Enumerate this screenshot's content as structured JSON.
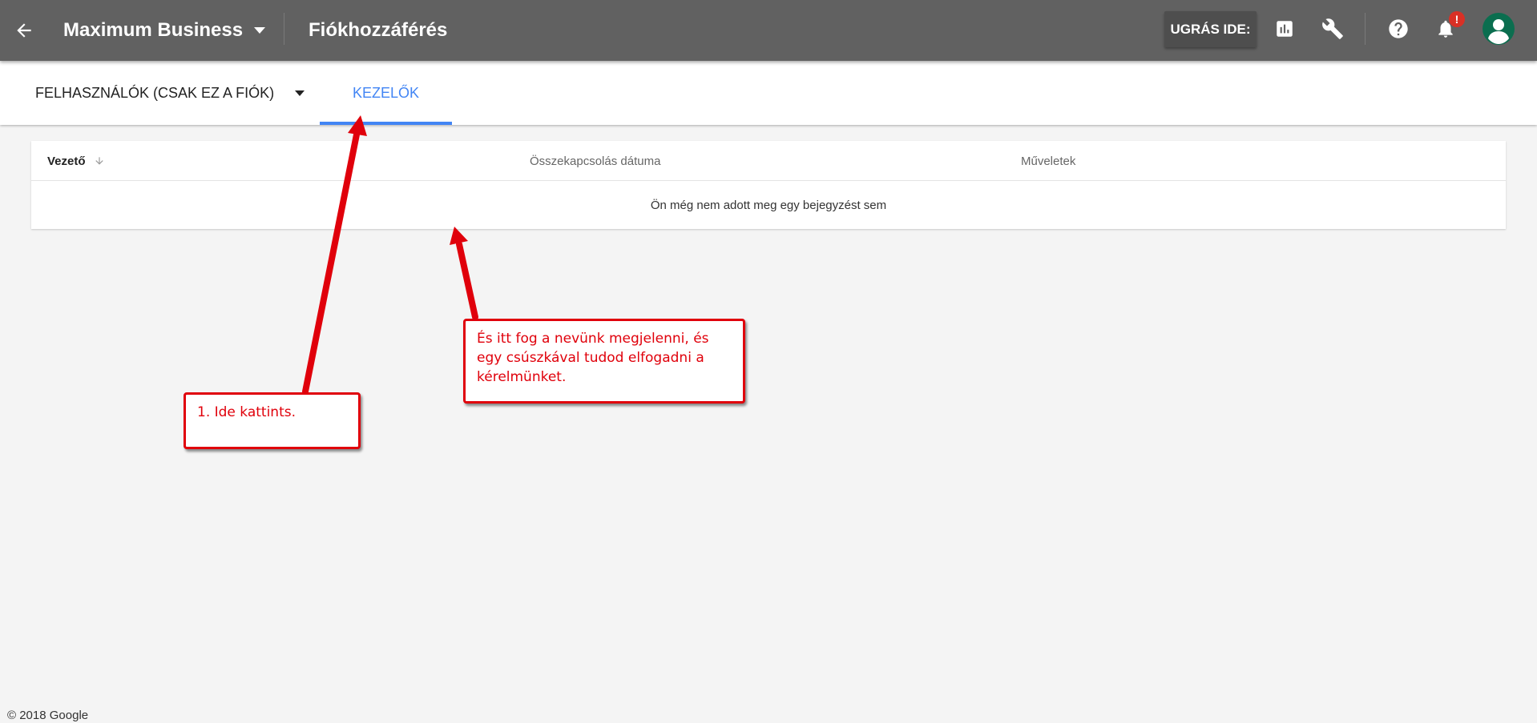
{
  "topbar": {
    "account_name": "Maximum Business",
    "page_title": "Fiókhozzáférés",
    "goto_label": "UGRÁS IDE:",
    "notification_badge": "!",
    "icons": {
      "back": "arrow-back-icon",
      "account_caret": "caret-down-icon",
      "reports": "bar-chart-icon",
      "tools": "wrench-icon",
      "help": "help-icon",
      "notifications": "bell-icon",
      "avatar": "account-avatar-icon"
    },
    "colors": {
      "bar": "#616161",
      "badge": "#d93025"
    }
  },
  "tabs": {
    "users_label": "FELHASZNÁLÓK (CSAK EZ A FIÓK)",
    "managers_label": "KEZELŐK",
    "active": "managers",
    "accent_color": "#4285f4"
  },
  "table": {
    "columns": [
      "Vezető",
      "Összekapcsolás dátuma",
      "Műveletek"
    ],
    "sort_column": "Vezető",
    "sort_direction": "descending",
    "empty_message": "Ön még nem adott meg egy bejegyzést sem"
  },
  "annotations": {
    "callout_1": "1. Ide kattints.",
    "callout_2": "És itt fog a nevünk megjelenni, és egy csúszkával tudod elfogadni a kérelmünket.",
    "color": "#e0000b"
  },
  "footer": {
    "copyright": "© 2018 Google"
  }
}
